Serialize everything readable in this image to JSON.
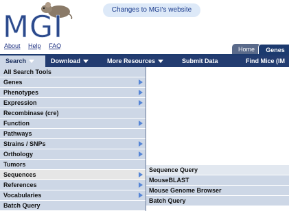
{
  "header": {
    "logo_text": "MGI",
    "changes_pill": "Changes to MGI's website",
    "util_links": [
      {
        "label": "About"
      },
      {
        "label": "Help"
      },
      {
        "label": "FAQ"
      }
    ],
    "tabs": {
      "home": "Home",
      "genes": "Genes"
    }
  },
  "navbar": {
    "items": [
      {
        "label": "Search"
      },
      {
        "label": "Download"
      },
      {
        "label": "More Resources"
      },
      {
        "label": "Submit Data"
      },
      {
        "label": "Find Mice (IM"
      }
    ]
  },
  "menu": {
    "items": [
      {
        "label": "All Search Tools"
      },
      {
        "label": "Genes"
      },
      {
        "label": "Phenotypes"
      },
      {
        "label": "Expression"
      },
      {
        "label": "Recombinase (cre)"
      },
      {
        "label": "Function"
      },
      {
        "label": "Pathways"
      },
      {
        "label": "Strains / SNPs"
      },
      {
        "label": "Orthology"
      },
      {
        "label": "Tumors"
      },
      {
        "label": "Sequences"
      },
      {
        "label": "References"
      },
      {
        "label": "Vocabularies"
      },
      {
        "label": "Batch Query"
      }
    ]
  },
  "submenu": {
    "items": [
      {
        "label": "Sequence Query"
      },
      {
        "label": "MouseBLAST"
      },
      {
        "label": "Mouse Genome Browser"
      },
      {
        "label": "Batch Query"
      }
    ]
  },
  "colors": {
    "navbar": "#233c70",
    "menu_bg": "#cdd7e6",
    "arrow": "#5585d6"
  }
}
